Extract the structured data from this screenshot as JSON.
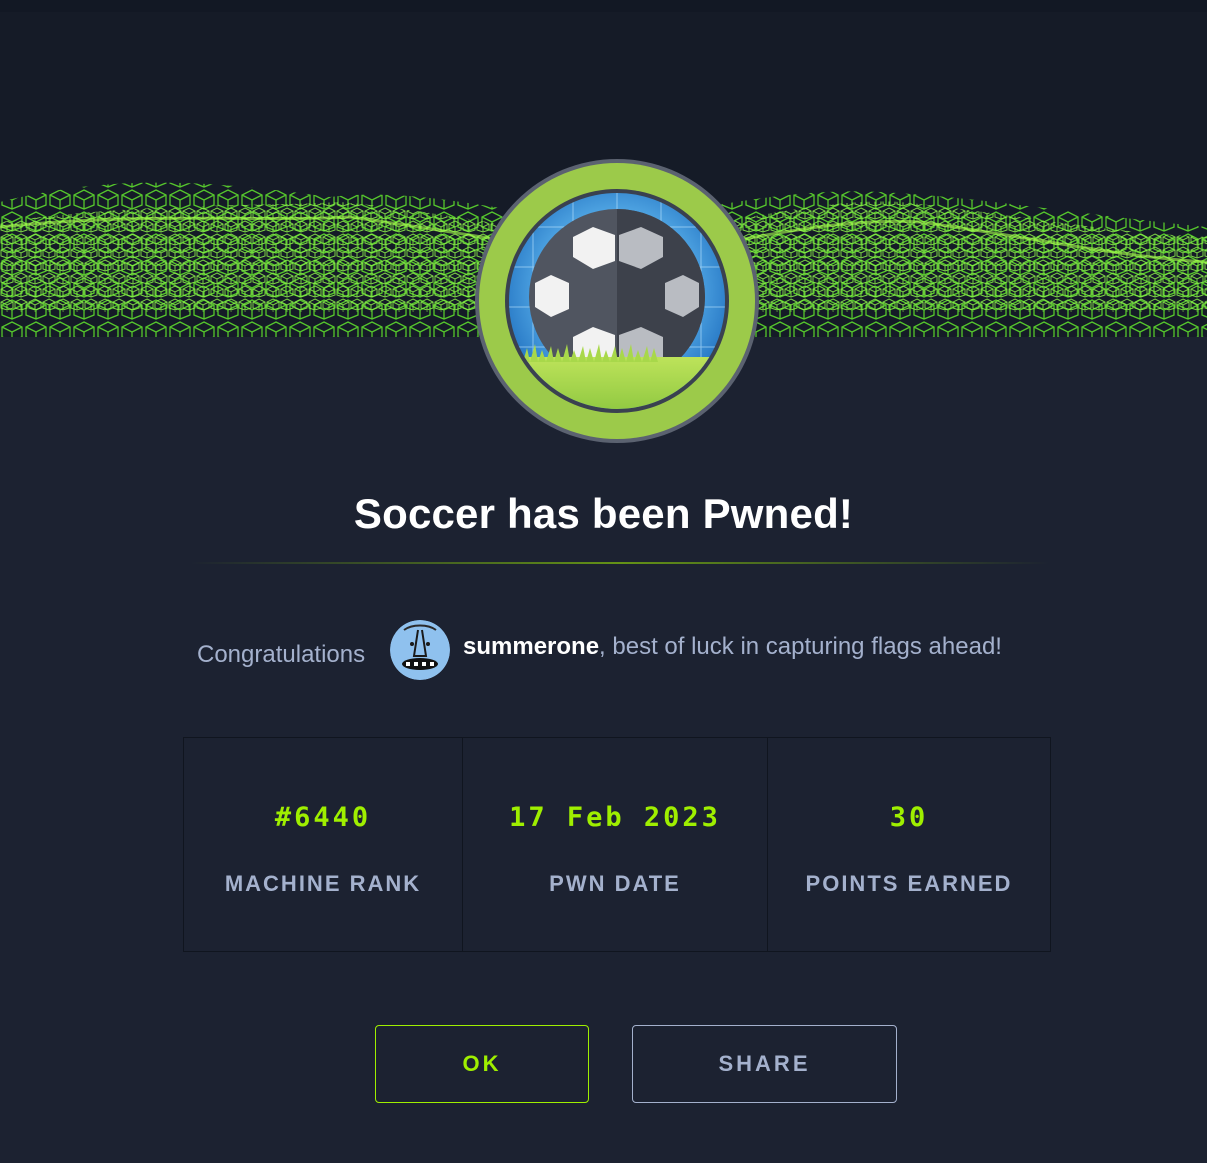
{
  "modal": {
    "title": "Soccer has been Pwned!",
    "badge_icon": "soccer-ball-badge",
    "congrats_label": "Congratulations",
    "username": "summerone",
    "congrats_suffix": ", best of luck in capturing flags ahead!"
  },
  "stats": [
    {
      "value": "#6440",
      "label": "MACHINE RANK"
    },
    {
      "value": "17 Feb 2023",
      "label": "PWN DATE"
    },
    {
      "value": "30",
      "label": "POINTS EARNED"
    }
  ],
  "buttons": {
    "ok_label": "OK",
    "share_label": "SHARE"
  },
  "colors": {
    "accent": "#9fef00",
    "background": "#1c2231",
    "text_muted": "#a4b1cd",
    "title": "#ffffff"
  }
}
